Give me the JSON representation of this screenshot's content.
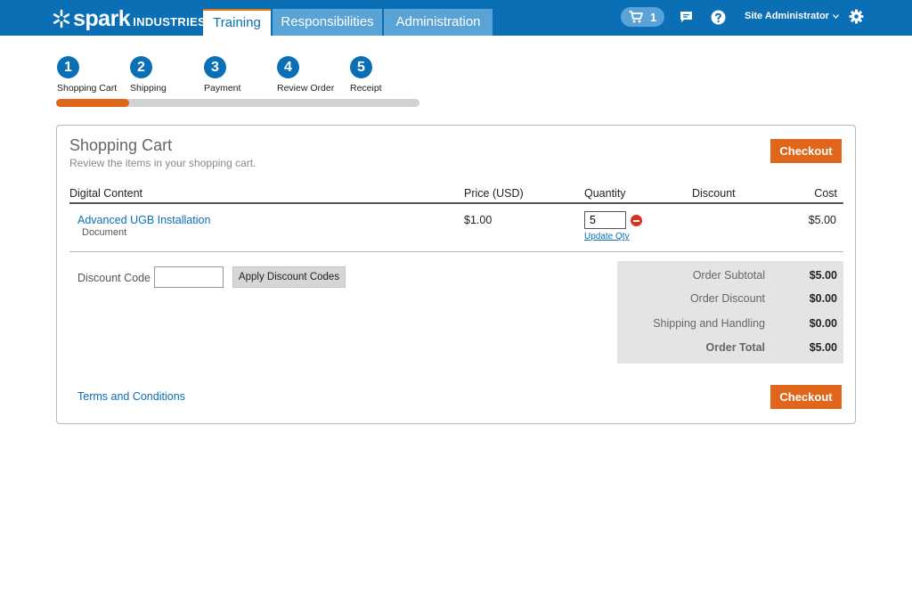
{
  "header": {
    "logo_word": "spark",
    "logo_sub": "INDUSTRIES",
    "tabs": [
      {
        "label": "Training",
        "active": true
      },
      {
        "label": "Responsibilities",
        "active": false
      },
      {
        "label": "Administration",
        "active": false
      }
    ],
    "cart_count": "1",
    "user_name": "Site Administrator",
    "icons": [
      "cart-icon",
      "chat-icon",
      "help-icon",
      "chevron-down-icon",
      "gear-icon"
    ]
  },
  "steps": {
    "items": [
      {
        "number": "1",
        "label": "Shopping Cart"
      },
      {
        "number": "2",
        "label": "Shipping"
      },
      {
        "number": "3",
        "label": "Payment"
      },
      {
        "number": "4",
        "label": "Review Order"
      },
      {
        "number": "5",
        "label": "Receipt"
      }
    ],
    "progress_fraction": 0.2
  },
  "cart": {
    "title": "Shopping Cart",
    "subtitle": "Review the items in your shopping cart.",
    "checkout_label": "Checkout",
    "columns": [
      "Digital Content",
      "Price (USD)",
      "Quantity",
      "Discount",
      "Cost"
    ],
    "items": [
      {
        "name": "Advanced UGB Installation",
        "type": "Document",
        "price": "$1.00",
        "quantity": "5",
        "update_label": "Update Qty",
        "discount": "",
        "cost": "$5.00"
      }
    ],
    "discount_code_label": "Discount Code",
    "discount_code_value": "",
    "apply_label": "Apply Discount Codes",
    "totals": [
      {
        "label": "Order Subtotal",
        "value": "$5.00"
      },
      {
        "label": "Order Discount",
        "value": "$0.00"
      },
      {
        "label": "Shipping and Handling",
        "value": "$0.00"
      },
      {
        "label": "Order Total",
        "value": "$5.00"
      }
    ],
    "terms_label": "Terms and Conditions"
  },
  "colors": {
    "brand_blue": "#0a6fb4",
    "tab_blue": "#5aa3d6",
    "accent_orange": "#e0661c",
    "remove_red": "#d6331f"
  }
}
